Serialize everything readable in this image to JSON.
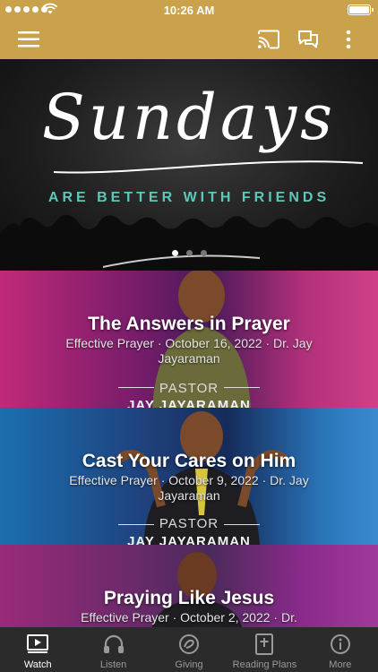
{
  "status_bar": {
    "time": "10:26 AM"
  },
  "hero": {
    "script_text": "Sundays",
    "tagline": "ARE BETTER WITH FRIENDS",
    "carousel_page": 1,
    "carousel_total": 3
  },
  "sermons": [
    {
      "title": "The Answers in Prayer",
      "meta": "Effective Prayer · October 16, 2022 · Dr. Jay Jayaraman",
      "banner_label": "PASTOR",
      "banner_name": "JAY JAYARAMAN"
    },
    {
      "title": "Cast Your Cares on Him",
      "meta": "Effective Prayer · October 9, 2022 · Dr. Jay Jayaraman",
      "banner_label": "PASTOR",
      "banner_name": "JAY JAYARAMAN"
    },
    {
      "title": "Praying Like Jesus",
      "meta": "Effective Prayer · October 2, 2022 · Dr."
    }
  ],
  "tabs": [
    {
      "label": "Watch",
      "icon": "watch-icon",
      "active": true
    },
    {
      "label": "Listen",
      "icon": "headphones-icon",
      "active": false
    },
    {
      "label": "Giving",
      "icon": "giving-icon",
      "active": false
    },
    {
      "label": "Reading Plans",
      "icon": "book-icon",
      "active": false
    },
    {
      "label": "More",
      "icon": "info-icon",
      "active": false
    }
  ],
  "colors": {
    "accent": "#c9a24b",
    "tagline": "#5cc9b8",
    "tabbar": "#2b2b2b"
  }
}
